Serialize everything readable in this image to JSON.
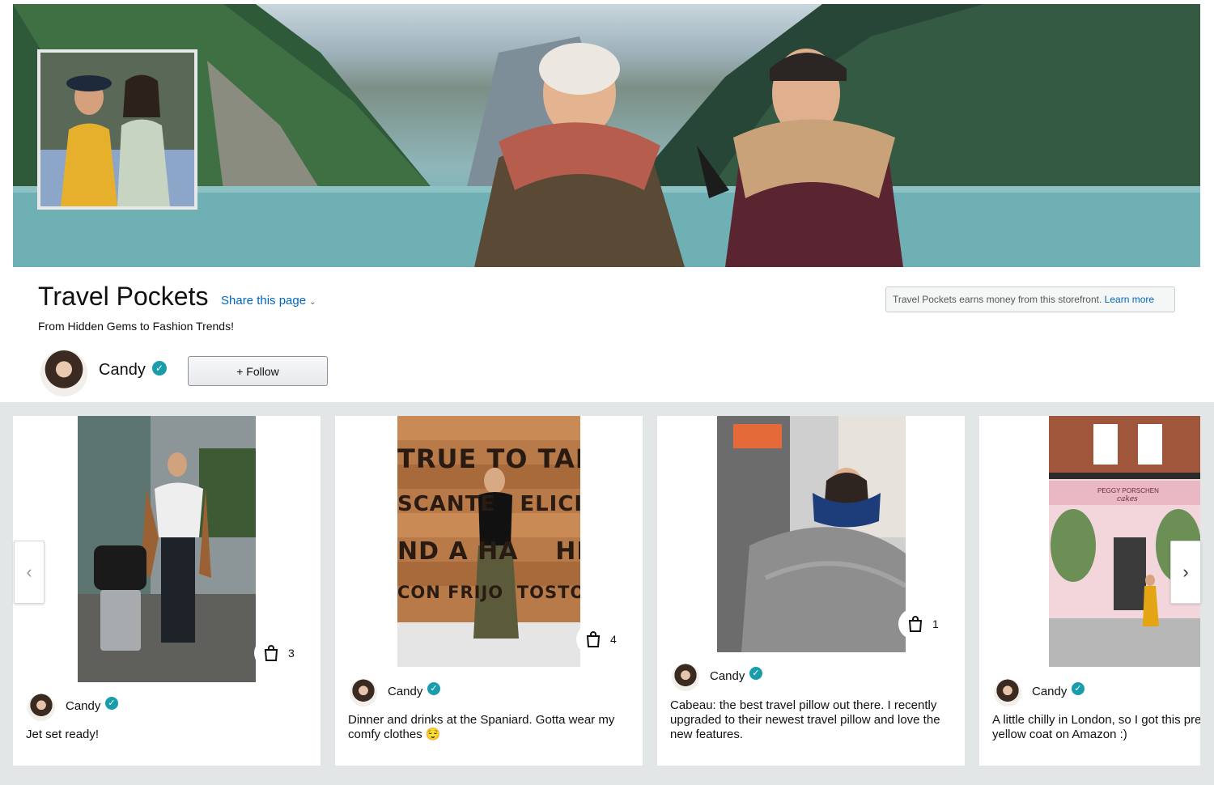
{
  "store": {
    "title": "Travel Pockets",
    "share_label": "Share this page",
    "tagline": "From Hidden Gems to Fashion Trends!",
    "earn_text": "Travel Pockets earns money from this storefront.",
    "learn_more": "Learn more"
  },
  "creator": {
    "name": "Candy",
    "follow_label": "+ Follow"
  },
  "icons": {
    "verified": "verified-check-icon",
    "bag": "shopping-bag-icon",
    "prev": "chevron-left-icon",
    "next": "chevron-right-icon",
    "share_chevron": "chevron-down-icon"
  },
  "colors": {
    "link": "#0066c0",
    "verified": "#199daa",
    "feed_background": "#e3e6e6"
  },
  "posts": [
    {
      "author": "Candy",
      "product_count": "3",
      "caption": "Jet set ready!"
    },
    {
      "author": "Candy",
      "product_count": "4",
      "caption": "Dinner and drinks at the Spaniard. Gotta wear my comfy clothes 😌"
    },
    {
      "author": "Candy",
      "product_count": "1",
      "caption": "Cabeau: the best travel pillow out there. I recently upgraded to their newest travel pillow and love the new features."
    },
    {
      "author": "Candy",
      "product_count": "",
      "caption": "A little chilly in London, so I got this pre yellow coat on Amazon :)"
    }
  ],
  "photo_signs": {
    "post2_sign": [
      "TRUE TO TAM",
      "SCANTE   ELICIO",
      "ND A HA    HEAR",
      "CON FRIJO  TOSTON"
    ],
    "post4_shop": "PEGGY PORSCHEN",
    "post4_shop_sub": "cakes"
  }
}
